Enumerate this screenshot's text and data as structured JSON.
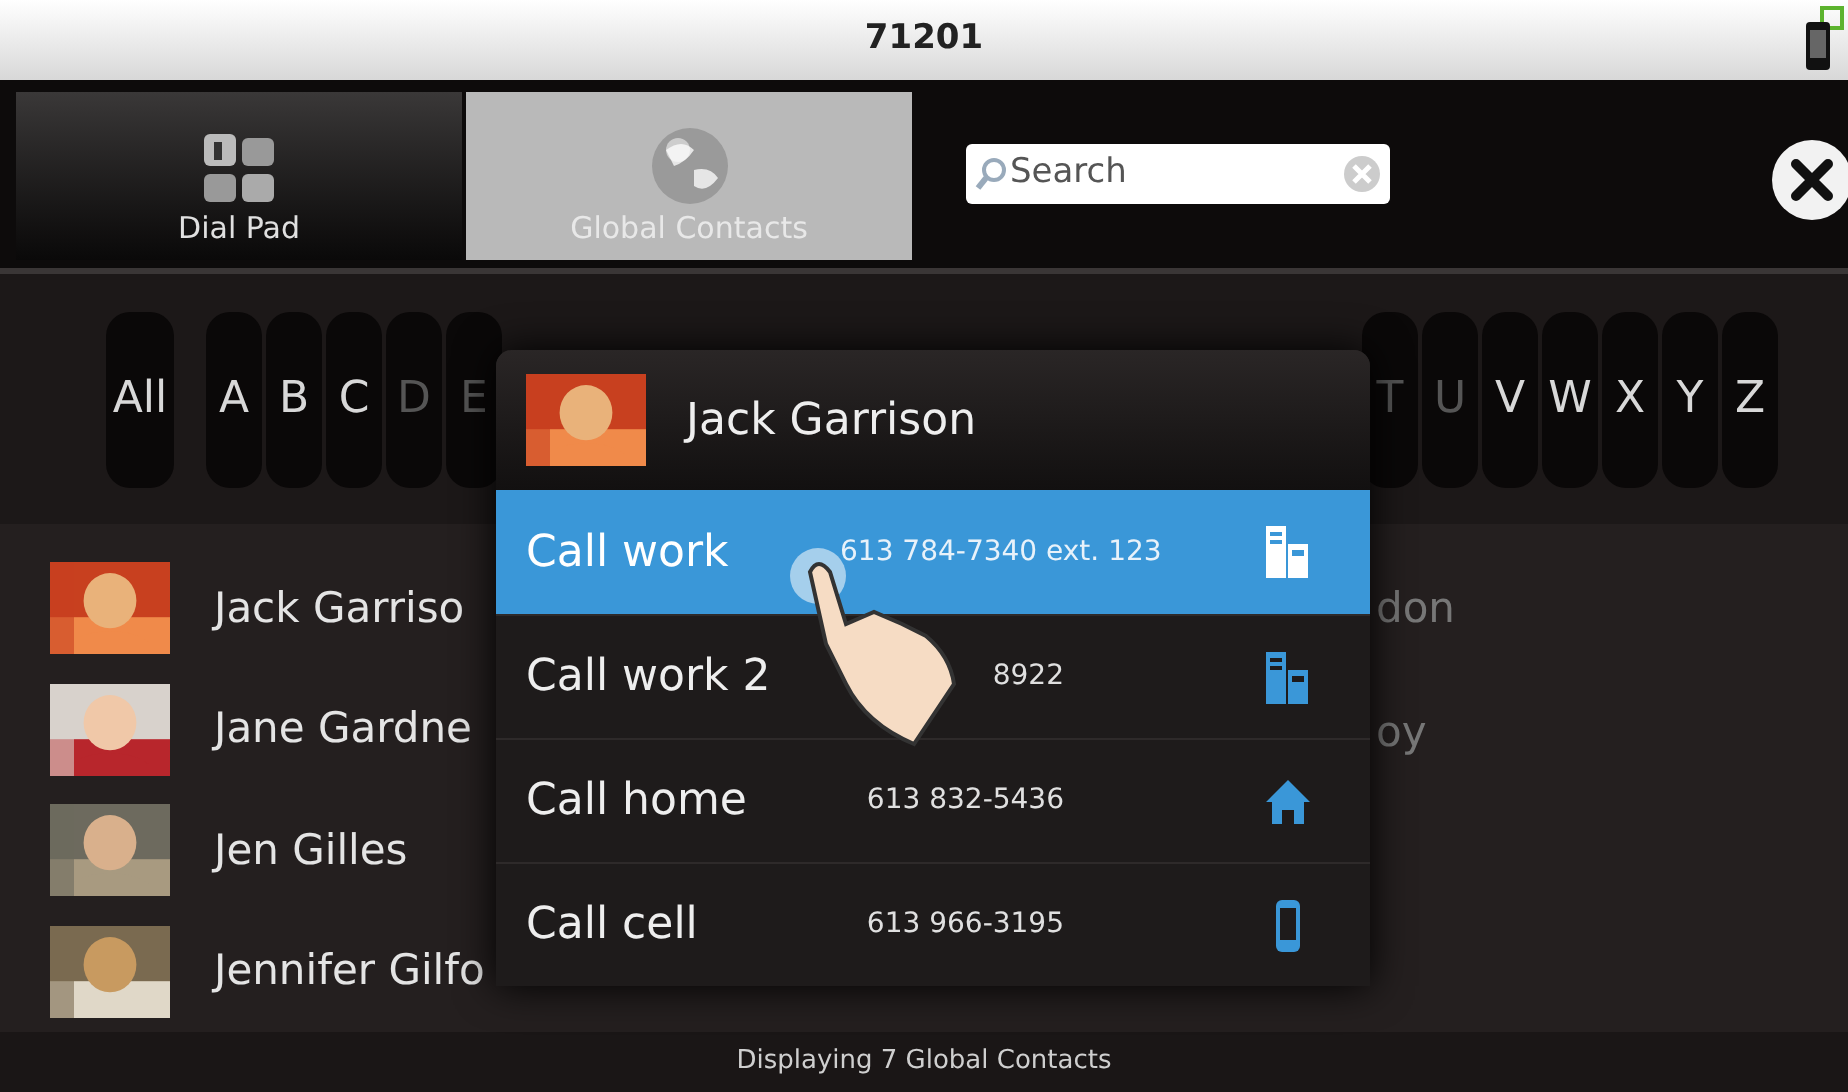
{
  "title_bar": {
    "title": "71201"
  },
  "tabs": [
    {
      "label": "Dial Pad",
      "kind": "dialpad",
      "selected": false
    },
    {
      "label": "Global Contacts",
      "kind": "globe",
      "selected": true
    }
  ],
  "search": {
    "placeholder": "Search"
  },
  "alphabet": {
    "left": [
      {
        "label": "All",
        "disabled": false
      },
      {
        "label": "A",
        "disabled": false
      },
      {
        "label": "B",
        "disabled": false
      },
      {
        "label": "C",
        "disabled": false
      },
      {
        "label": "D",
        "disabled": true
      },
      {
        "label": "E",
        "disabled": true
      }
    ],
    "right": [
      {
        "label": "T",
        "disabled": true
      },
      {
        "label": "U",
        "disabled": true
      },
      {
        "label": "V",
        "disabled": false
      },
      {
        "label": "W",
        "disabled": false
      },
      {
        "label": "X",
        "disabled": false
      },
      {
        "label": "Y",
        "disabled": false
      },
      {
        "label": "Z",
        "disabled": false
      }
    ]
  },
  "contacts": [
    {
      "name": "Jack Garriso"
    },
    {
      "name": "Jane Gardne"
    },
    {
      "name": "Jen Gilles"
    },
    {
      "name": "Jennifer Gilfo"
    }
  ],
  "contacts_column_2": [
    {
      "name": "don"
    },
    {
      "name": "oy"
    }
  ],
  "popup": {
    "name": "Jack Garrison",
    "actions": [
      {
        "label": "Call work",
        "number": "613 784-7340 ext. 123",
        "kind": "work",
        "selected": true
      },
      {
        "label": "Call work 2",
        "number": "8922",
        "kind": "work",
        "selected": false
      },
      {
        "label": "Call home",
        "number": "613 832-5436",
        "kind": "home",
        "selected": false
      },
      {
        "label": "Call cell",
        "number": "613 966-3195",
        "kind": "cell",
        "selected": false
      }
    ]
  },
  "status_bar": {
    "text": "Displaying 7 Global Contacts"
  }
}
